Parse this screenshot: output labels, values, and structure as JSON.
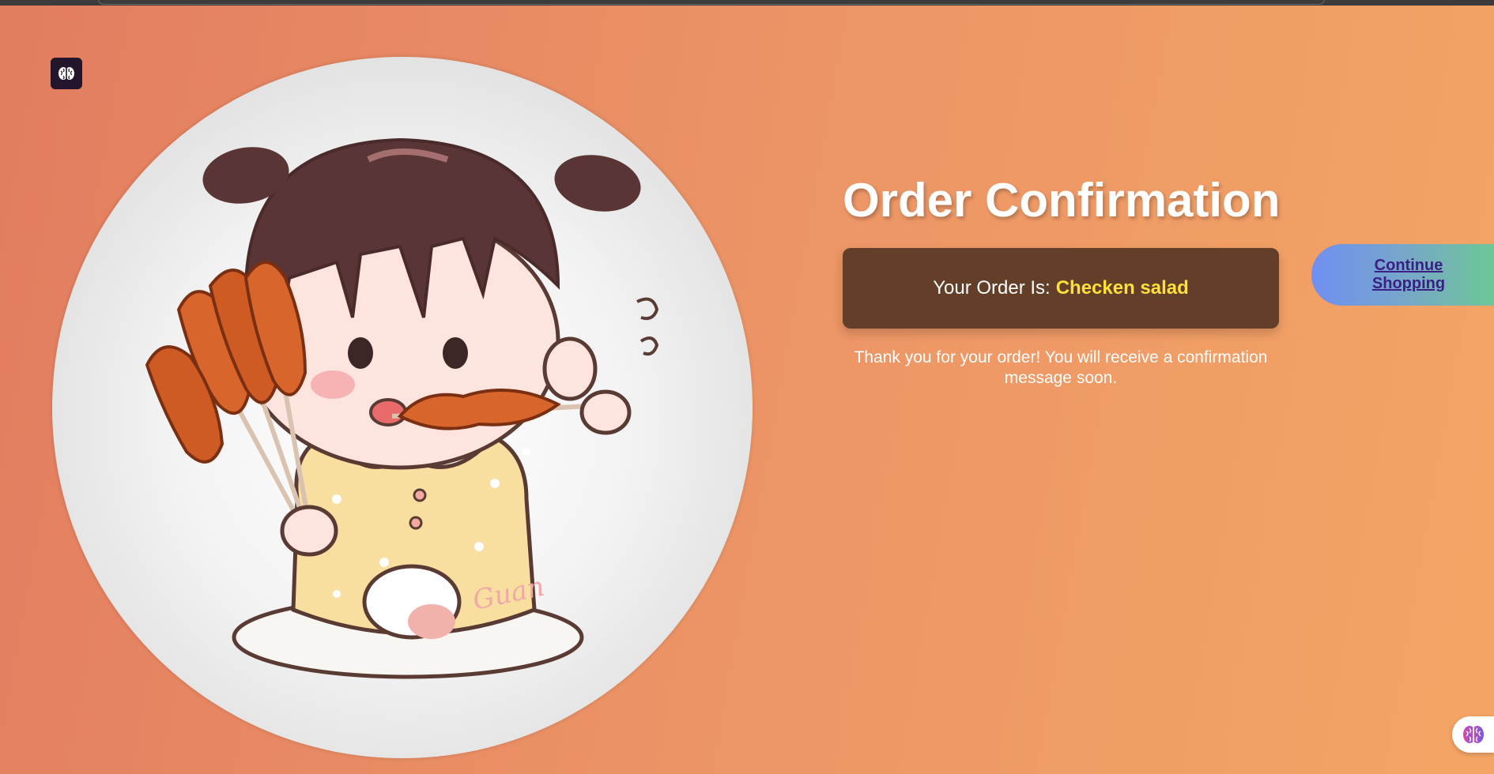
{
  "page": {
    "title": "Order Confirmation",
    "order_label": "Your Order Is:",
    "order_value": "Checken salad",
    "thank_you_message": "Thank you for your order! You will receive a confirmation message soon.",
    "continue_label": "Continue Shopping"
  },
  "illustration": {
    "signature": "Guan",
    "description_icon": "child-eating-skewers-illustration"
  },
  "icons": {
    "app": "brain-icon",
    "assistant": "brain-icon"
  },
  "colors": {
    "background_start": "#e27d60",
    "background_end": "#f4a565",
    "order_box": "#633e28",
    "order_value": "#ffe03b",
    "button_start": "#6f8ff2",
    "button_end": "#6cc796",
    "button_text": "#3b1f86"
  }
}
